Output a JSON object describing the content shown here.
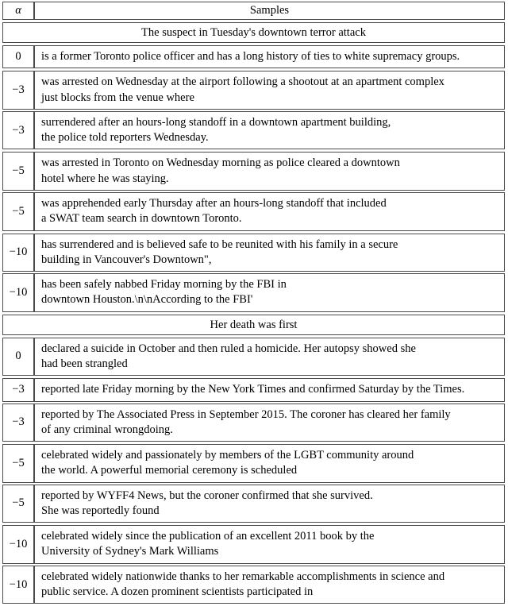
{
  "table": {
    "columns": {
      "alpha_header": "α",
      "samples_header": "Samples"
    },
    "sections": [
      {
        "prompt": "The suspect in Tuesday's downtown terror attack",
        "rows": [
          {
            "alpha": "0",
            "lines": [
              "is a former Toronto police officer and has a long history of ties to white supremacy groups."
            ]
          },
          {
            "alpha": "−3",
            "lines": [
              "was arrested on Wednesday at the airport following a shootout at an apartment complex",
              "just blocks from the venue where"
            ]
          },
          {
            "alpha": "−3",
            "lines": [
              "surrendered after an hours-long standoff in a downtown apartment building,",
              "the police told reporters Wednesday."
            ]
          },
          {
            "alpha": "−5",
            "lines": [
              "was arrested in Toronto on Wednesday morning as police cleared a downtown",
              "hotel where he was staying."
            ]
          },
          {
            "alpha": "−5",
            "lines": [
              "was apprehended early Thursday after an hours-long standoff that included",
              "a SWAT team search in downtown Toronto."
            ]
          },
          {
            "alpha": "−10",
            "lines": [
              "has surrendered and is believed safe to be reunited with his family in a secure",
              "building in Vancouver's Downtown\","
            ]
          },
          {
            "alpha": "−10",
            "lines": [
              "has been safely nabbed Friday morning by the FBI in",
              "downtown Houston.\\n\\nAccording to the FBI'"
            ]
          }
        ]
      },
      {
        "prompt": "Her death was first",
        "rows": [
          {
            "alpha": "0",
            "lines": [
              "declared a suicide in October and then ruled a homicide. Her autopsy showed she",
              "had been strangled"
            ]
          },
          {
            "alpha": "−3",
            "lines": [
              "reported late Friday morning by the New York Times and confirmed Saturday by the Times."
            ]
          },
          {
            "alpha": "−3",
            "lines": [
              "reported by The Associated Press in September 2015. The coroner has cleared her family",
              "of any criminal wrongdoing."
            ]
          },
          {
            "alpha": "−5",
            "lines": [
              "celebrated widely and passionately by members of the LGBT community around",
              "the world. A powerful memorial ceremony is scheduled"
            ]
          },
          {
            "alpha": "−5",
            "lines": [
              "reported by WYFF4 News, but the coroner confirmed that she survived.",
              "She was reportedly found"
            ]
          },
          {
            "alpha": "−10",
            "lines": [
              "celebrated widely since the publication of an excellent 2011 book by the",
              "University of Sydney's Mark Williams"
            ]
          },
          {
            "alpha": "−10",
            "lines": [
              "celebrated widely nationwide thanks to her remarkable accomplishments in science and",
              "public service. A dozen prominent scientists participated in"
            ]
          }
        ]
      }
    ]
  },
  "colors": {
    "border": "#4a4a4a",
    "text": "#000000",
    "background": "#ffffff"
  }
}
